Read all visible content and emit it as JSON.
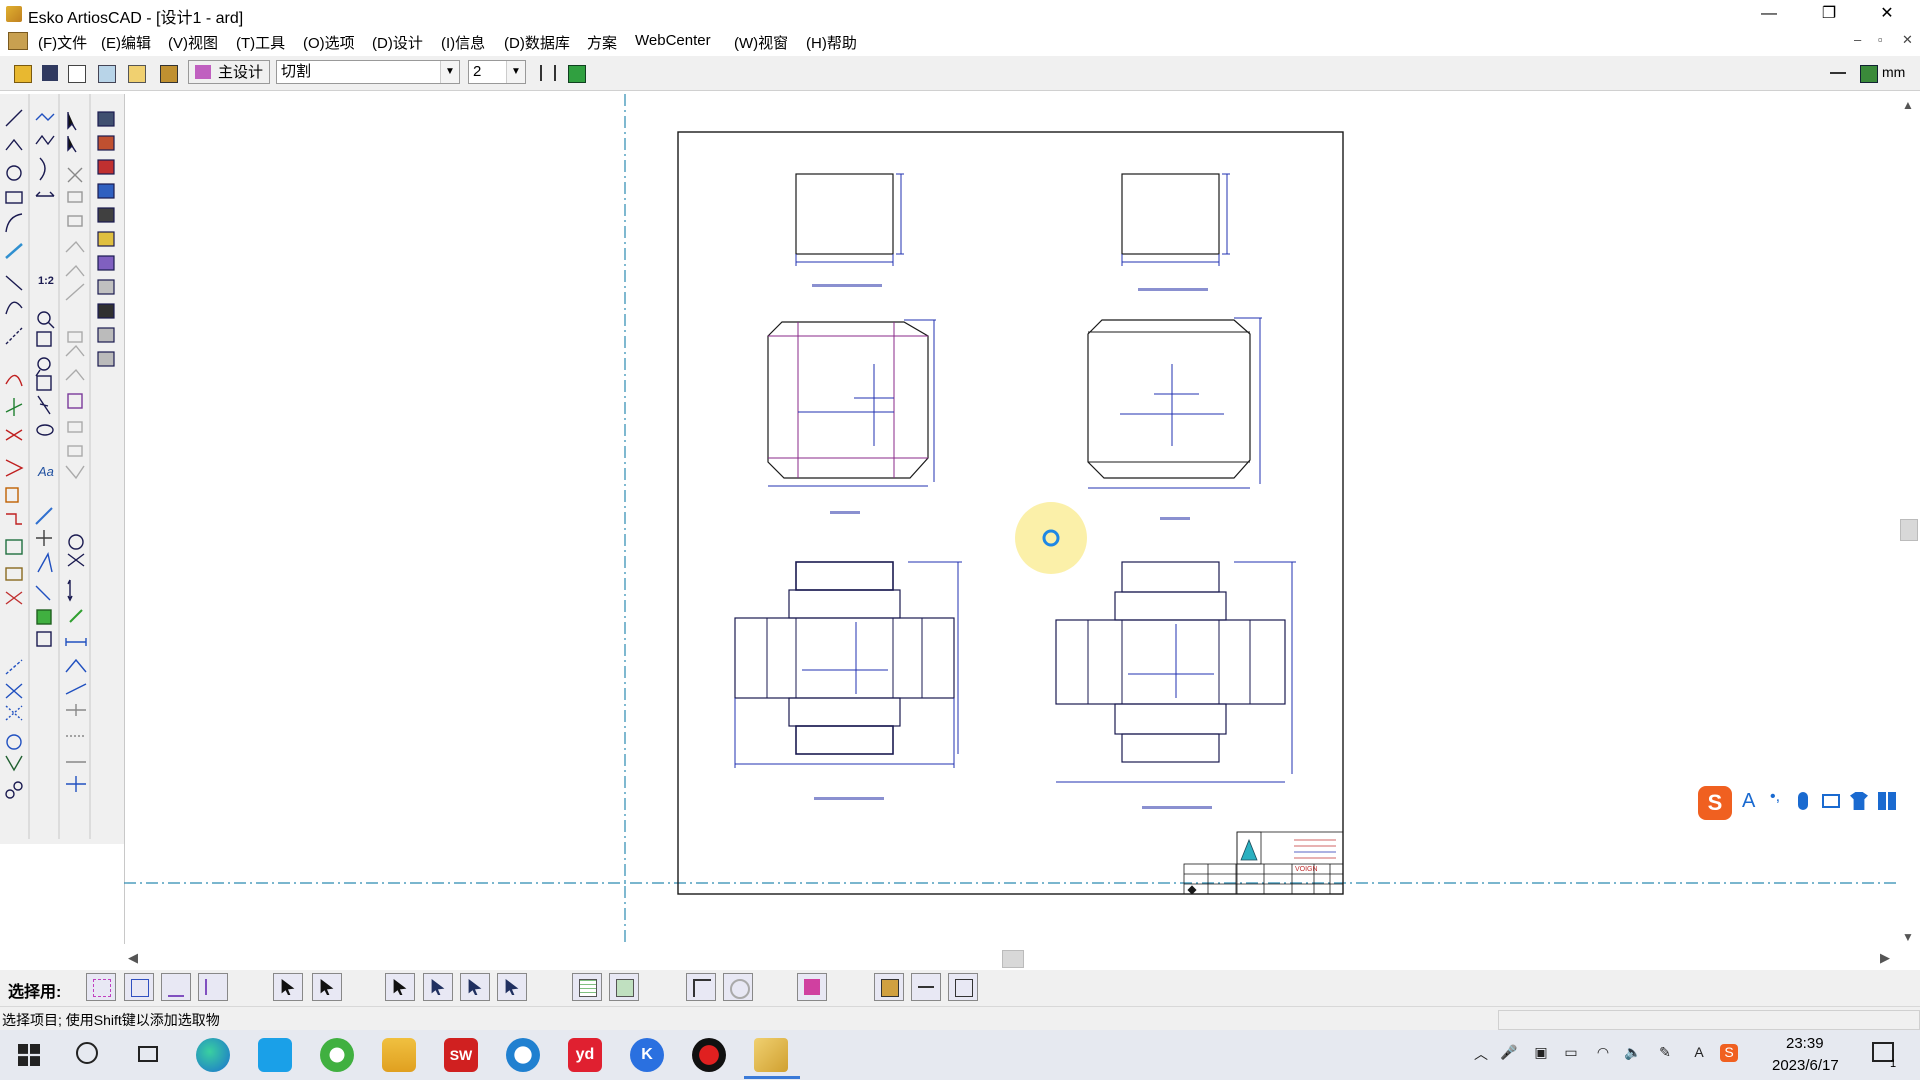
{
  "window": {
    "title": "Esko ArtiosCAD - [设计1 - ard]",
    "minimize": "—",
    "maximize": "❐",
    "close": "✕"
  },
  "menu": {
    "items": [
      "(F)文件",
      "(E)编辑",
      "(V)视图",
      "(T)工具",
      "(O)选项",
      "(D)设计",
      "(I)信息",
      "(D)数据库",
      "方案",
      "WebCenter",
      "(W)视窗",
      "(H)帮助"
    ],
    "mdi_min": "–",
    "mdi_restore": "▫",
    "mdi_close": "✕"
  },
  "toolbar": {
    "main_design_label": "主设计",
    "layer_combo_value": "切割",
    "width_combo_value": "2",
    "units_label": "mm"
  },
  "select_bar": {
    "label": "选择用:"
  },
  "status": {
    "text": "选择项目; 使用Shift键以添加选取物"
  },
  "drawing": {
    "title_block_brand": "VOIGN",
    "colors": {
      "outline": "#1a1a1a",
      "dimension": "#2030b0",
      "crease": "#8a2a8a",
      "guide": "#2a8ab0",
      "cursor_halo": "#fbeea0",
      "cursor_ring": "#1e88e5"
    }
  },
  "taskbar": {
    "time": "23:39",
    "date": "2023/6/17",
    "notification_count": "1",
    "icons": [
      "start-icon",
      "search-icon",
      "task-view-icon",
      "edge-icon",
      "c-app-icon",
      "browser-icon",
      "file-explorer-icon",
      "solidworks-icon",
      "sync-icon",
      "youdao-icon",
      "k-app-icon",
      "record-icon",
      "artioscad-icon"
    ],
    "solidworks_badge": "SW",
    "youdao_badge": "yd",
    "k_badge": "K"
  },
  "ime": {
    "letter": "A",
    "punct": "•,"
  }
}
